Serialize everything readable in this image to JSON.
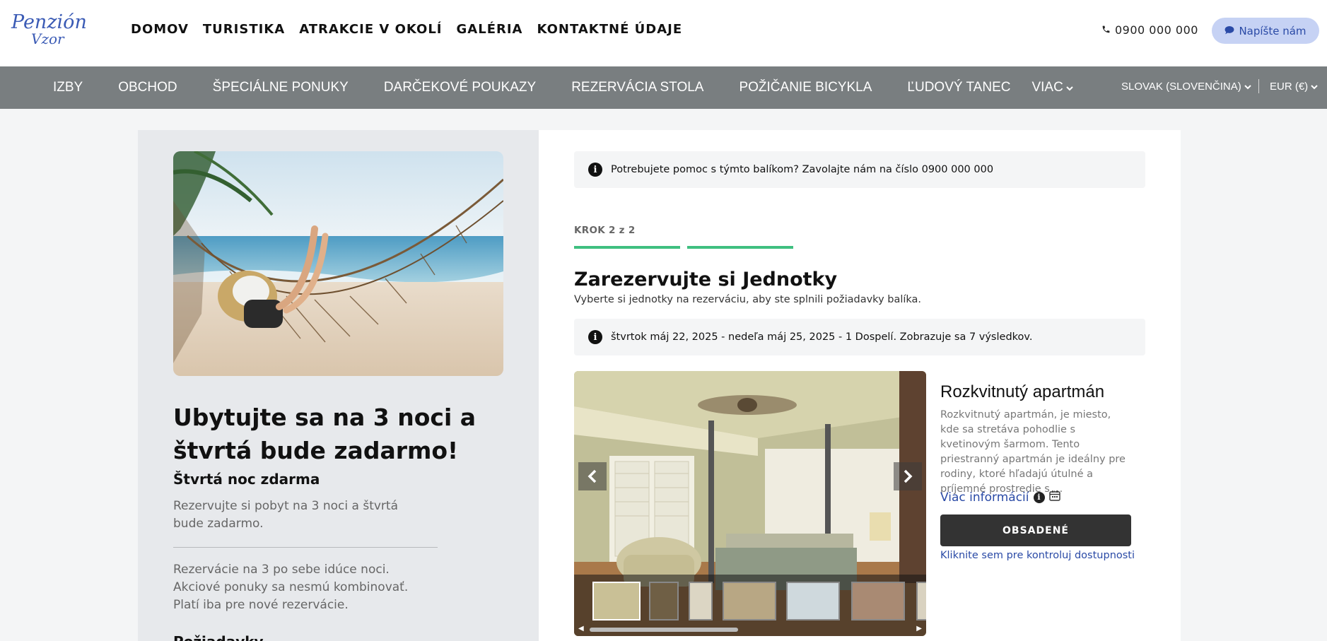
{
  "header": {
    "logo_line1": "Penzión",
    "logo_line2": "Vzor",
    "nav": [
      "DOMOV",
      "TURISTIKA",
      "ATRAKCIE V OKOLÍ",
      "GALÉRIA",
      "KONTAKTNÉ ÚDAJE"
    ],
    "phone": "0900 000 000",
    "write_button": "Napíšte nám"
  },
  "subnav": {
    "items": [
      "IZBY",
      "OBCHOD",
      "ŠPECIÁLNE PONUKY",
      "DARČEKOVÉ POUKAZY",
      "REZERVÁCIA STOLA",
      "POŽIČANIE BICYKLA",
      "ĽUDOVÝ TANEC"
    ],
    "more": "VIAC",
    "language": "SLOVAK (SLOVENČINA)",
    "currency": "EUR (€)"
  },
  "offer": {
    "title": "Ubytujte sa na 3 noci a štvrtá bude zadarmo!",
    "subtitle": "Štvrtá noc zdarma",
    "description": "Rezervujte si pobyt na 3 noci a štvrtá bude zadarmo.",
    "terms": "Rezervácie na 3 po sebe idúce noci. Akciové ponuky sa nesmú kombinovať. Platí iba pre nové rezervácie.",
    "requirements_title": "Požiadavky"
  },
  "booking": {
    "help_text": "Potrebujete pomoc s týmto balíkom? Zavolajte nám na číslo 0900 000 000",
    "step": "KROK 2 z 2",
    "title": "Zarezervujte si Jednotky",
    "subtitle": "Vyberte si jednotky na rezerváciu, aby ste splnili požiadavky balíka.",
    "date_info": "štvrtok máj 22, 2025 - nedeľa máj 25, 2025 - 1 Dospelí. Zobrazuje sa 7 výsledkov."
  },
  "unit": {
    "name": "Rozkvitnutý apartmán",
    "description": "Rozkvitnutý apartmán, je miesto, kde sa stretáva pohodlie s kvetinovým šarmom. Tento priestranný apartmán je ideálny pre rodiny, ktoré hľadajú útulné a príjemné prostredie s ...",
    "more_info": "Viac informácií",
    "status_button": "OBSADENÉ",
    "check_link": "Kliknite sem pre kontroluj dostupnosti"
  },
  "colors": {
    "accent_blue": "#2a4aa6",
    "progress_green": "#3fbf80",
    "subnav_gray": "#797e80"
  }
}
